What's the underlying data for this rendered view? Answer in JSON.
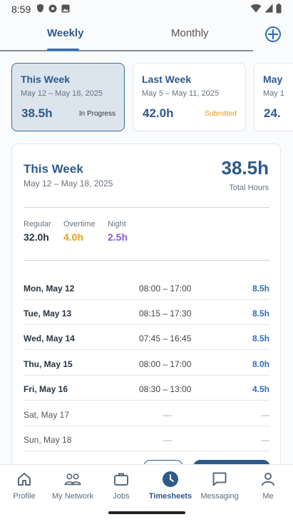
{
  "status_bar": {
    "time": "8:59"
  },
  "tabs": {
    "weekly": "Weekly",
    "monthly": "Monthly"
  },
  "week_cards": [
    {
      "title": "This Week",
      "dates": "May 12 – May 18, 2025",
      "hours": "38.5h",
      "status": "In Progress"
    },
    {
      "title": "Last Week",
      "dates": "May 5 – May 11, 2025",
      "hours": "42.0h",
      "status": "Submitted"
    },
    {
      "title": "May",
      "dates": "May 1",
      "hours": "24."
    }
  ],
  "detail": {
    "title": "This Week",
    "dates": "May 12 – May 18, 2025",
    "total": "38.5h",
    "total_label": "Total Hours",
    "breakdown": [
      {
        "label": "Regular",
        "value": "32.0h"
      },
      {
        "label": "Overtime",
        "value": "4.0h"
      },
      {
        "label": "Night",
        "value": "2.5h"
      }
    ],
    "days": [
      {
        "day": "Mon, May 12",
        "range": "08:00 – 17:00",
        "hours": "8.5h"
      },
      {
        "day": "Tue, May 13",
        "range": "08:15 – 17:30",
        "hours": "8.5h"
      },
      {
        "day": "Wed, May 14",
        "range": "07:45 – 16:45",
        "hours": "8.5h"
      },
      {
        "day": "Thu, May 15",
        "range": "08:00 – 17:00",
        "hours": "8.0h"
      },
      {
        "day": "Fri, May 16",
        "range": "08:30 – 13:00",
        "hours": "4.5h"
      },
      {
        "day": "Sat, May 17",
        "range": "—",
        "hours": "—"
      },
      {
        "day": "Sun, May 18",
        "range": "—",
        "hours": "—"
      }
    ]
  },
  "nav": [
    {
      "label": "Profile",
      "icon": "home-icon"
    },
    {
      "label": "My Network",
      "icon": "people-icon"
    },
    {
      "label": "Jobs",
      "icon": "briefcase-icon"
    },
    {
      "label": "Timesheets",
      "icon": "clock-icon"
    },
    {
      "label": "Messaging",
      "icon": "message-icon"
    },
    {
      "label": "Me",
      "icon": "person-icon"
    }
  ],
  "colors": {
    "primary": "#2d5a8a",
    "accent": "#2f6fb5",
    "overtime": "#e6a015",
    "night": "#8a5cd6",
    "submitted": "#e09a1a"
  }
}
